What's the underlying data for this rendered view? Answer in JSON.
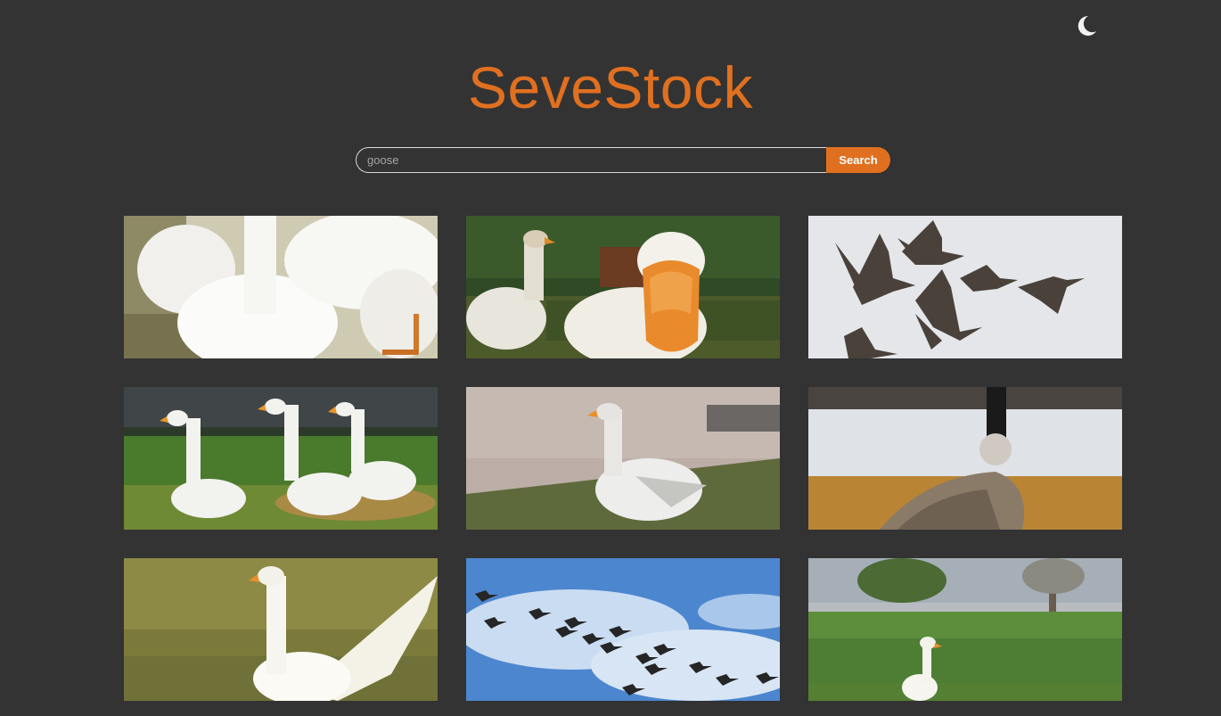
{
  "header": {
    "logo_text": "SeveStock",
    "theme_toggle_icon": "moon-icon"
  },
  "search": {
    "value": "goose",
    "button_label": "Search"
  },
  "colors": {
    "background": "#333333",
    "accent": "#e07020",
    "input_border": "#d8d8d8"
  },
  "results": [
    {
      "subject": "white domestic geese close-up by water"
    },
    {
      "subject": "white goose with orange beak close-up near pond"
    },
    {
      "subject": "flock of canada geese flying against pale sky"
    },
    {
      "subject": "three white geese walking on grass"
    },
    {
      "subject": "white goose standing on dirt path"
    },
    {
      "subject": "canada goose by a lake in autumn field"
    },
    {
      "subject": "white goose spreading wings in water"
    },
    {
      "subject": "flock of geese flying in blue sky"
    },
    {
      "subject": "white goose on a green meadow"
    }
  ]
}
